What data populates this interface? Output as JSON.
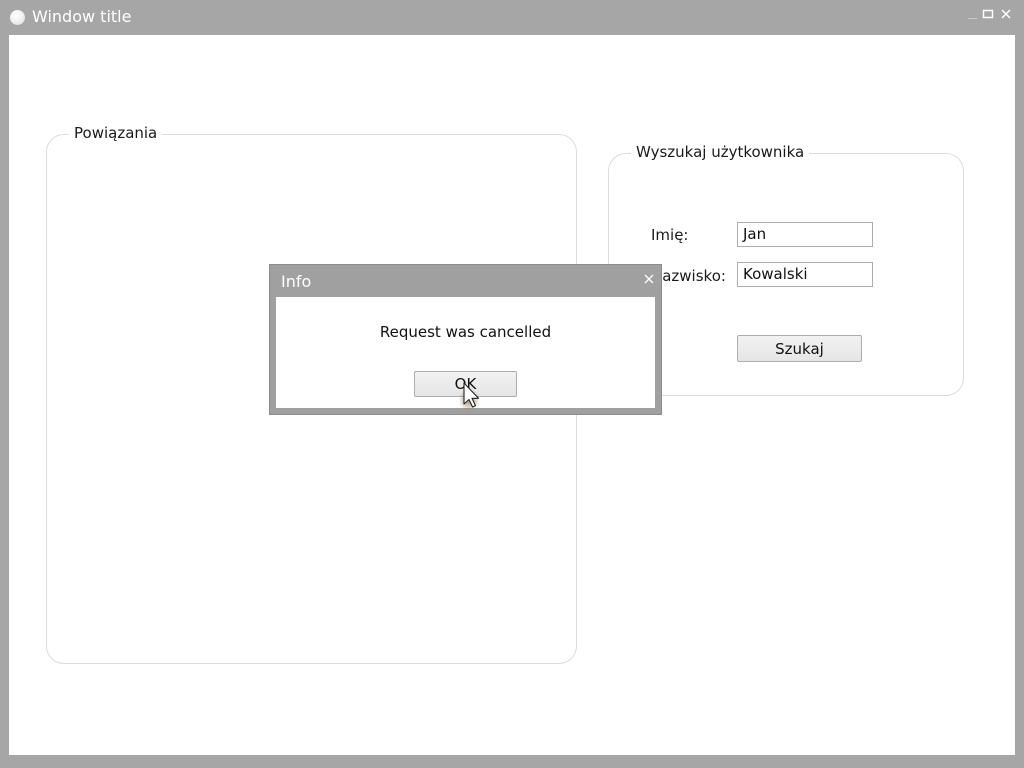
{
  "window": {
    "title": "Window title",
    "controls": {
      "minimize_icon": "minimize-icon",
      "maximize_icon": "maximize-icon",
      "close_icon": "close-icon"
    }
  },
  "groups": {
    "relations": {
      "legend": "Powiązania"
    },
    "search": {
      "legend": "Wyszukaj użytkownika",
      "first_name_label": "Imię:",
      "first_name_value": "Jan",
      "last_name_label": "Nazwisko:",
      "last_name_value": "Kowalski",
      "search_button": "Szukaj"
    }
  },
  "dialog": {
    "title": "Info",
    "message": "Request was cancelled",
    "ok_button": "OK"
  },
  "colors": {
    "frame": "#a6a6a6",
    "client_background": "#ffffff",
    "group_border": "#dcdcdc"
  }
}
